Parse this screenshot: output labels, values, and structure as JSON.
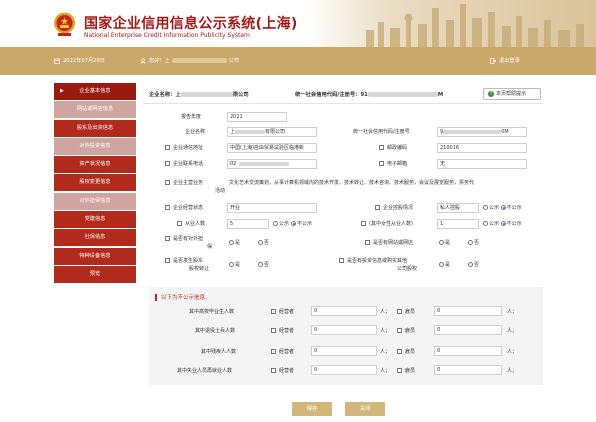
{
  "header": {
    "title_cn": "国家企业信用信息公示系统(上海)",
    "title_en": "National Enterprise Credit Information Publicity System"
  },
  "topbar": {
    "date": "2022年07月28日",
    "greeting_prefix": "您好！上",
    "greeting_suffix": "公司",
    "logout": "退出登录"
  },
  "sidebar": {
    "items": [
      {
        "label": "企业基本信息",
        "style": "active"
      },
      {
        "label": "网站或网店信息",
        "style": "light"
      },
      {
        "label": "股东及出资信息",
        "style": "dark"
      },
      {
        "label": "对外投资信息",
        "style": "light"
      },
      {
        "label": "资产状况信息",
        "style": "dark"
      },
      {
        "label": "股权变更信息",
        "style": "dark"
      },
      {
        "label": "对外担保信息",
        "style": "light"
      },
      {
        "label": "党建信息",
        "style": "dark"
      },
      {
        "label": "社保信息",
        "style": "dark"
      },
      {
        "label": "特种设备信息",
        "style": "dark"
      },
      {
        "label": "预览",
        "style": "dark"
      }
    ]
  },
  "company_line": {
    "name_label": "企业名称：上",
    "name_suffix": "限公司",
    "uscc_label": "统一社会信用代码/注册号：91",
    "uscc_suffix": "M",
    "help_button": "本页帮助提示"
  },
  "form": {
    "report_year_label": "报告年度",
    "report_year_value": "2021",
    "company_name_label": "企业名称",
    "company_name_value_a": "上",
    "company_name_value_b": "有限公司",
    "uscc_label": "统一社会信用代码/注册号",
    "uscc_value_a": "9",
    "uscc_value_b": "0M",
    "address_label": "企业通信地址",
    "address_value": "中国(上海)自由贸易试验区临港新",
    "postal_label": "邮政编码",
    "postal_value": "210016",
    "phone_label": "企业联系电话",
    "phone_value": "02",
    "email_label": "电子邮箱",
    "email_value": "无",
    "business_label_1": "企业主营业务",
    "business_label_2": "活动",
    "business_value": "文化艺术交流策划，从事计算机领域内的技术开发、技术转让、技术咨询、技术服务，会议及展览服务，票务代",
    "status_label": "企业经营状态",
    "status_value": "开业",
    "holding_label": "企业控股情况",
    "holding_value": "私人控股",
    "employees_label": "从业人数",
    "employees_value": "5",
    "female_label": "(其中女性从业人数)",
    "female_value": "1",
    "guarantee_label_1": "是否有对外担",
    "guarantee_label_2": "保",
    "website_label": "是否有网站或网店",
    "equity_label_1": "是否发生股东",
    "equity_label_2": "股权转让",
    "invest_label_1": "是否有投资信息或购买其他",
    "invest_label_2": "公司股权",
    "public": "公示",
    "not_public": "不公示",
    "yes": "是",
    "no": "否"
  },
  "not_public_section": {
    "title": "以下为不公示信息",
    "rows": [
      {
        "label": "其中高校毕业生人数"
      },
      {
        "label": "其中退役士兵人数"
      },
      {
        "label": "其中残疾人人数"
      },
      {
        "label": "其中失业人员再就业人数"
      }
    ],
    "operator": "经营者",
    "employee": "雇员",
    "value": "0",
    "unit": "人；"
  },
  "buttons": {
    "save": "保存",
    "close": "关闭"
  },
  "colors": {
    "gold": "#c9a86a",
    "red": "#b22a1c",
    "light_red": "#cfa5a0",
    "button": "#d2b77b"
  }
}
